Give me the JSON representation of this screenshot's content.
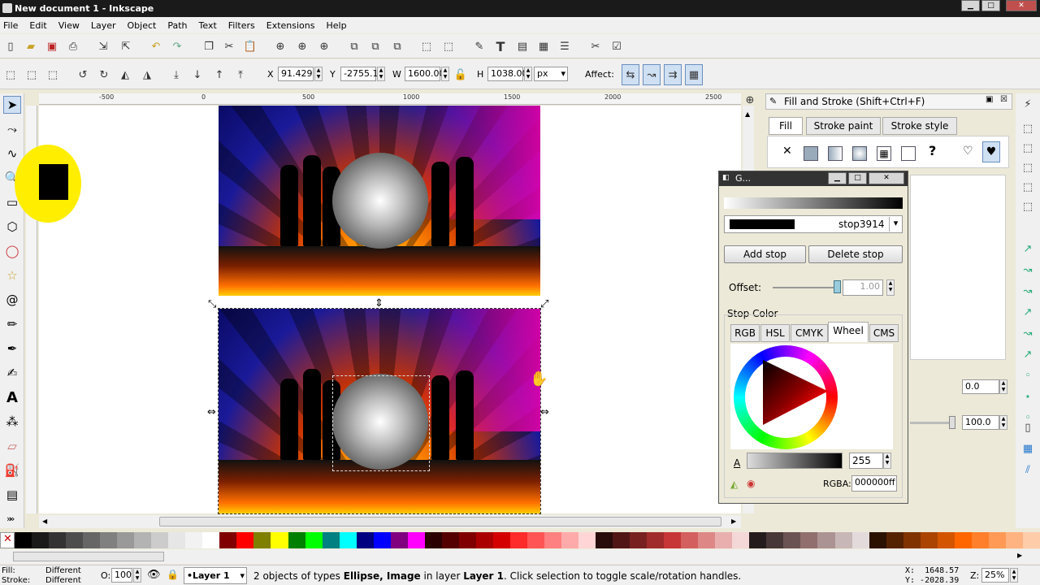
{
  "window": {
    "title": "New document 1 - Inkscape"
  },
  "menu": [
    "File",
    "Edit",
    "View",
    "Layer",
    "Object",
    "Path",
    "Text",
    "Filters",
    "Extensions",
    "Help"
  ],
  "toolbar": {
    "x_label": "X",
    "x_value": "91.429",
    "y_label": "Y",
    "y_value": "-2755.1!",
    "w_label": "W",
    "w_value": "1600.00",
    "h_label": "H",
    "h_value": "1038.00",
    "unit": "px",
    "affect_label": "Affect:"
  },
  "ruler": {
    "marks": [
      "-500",
      "0",
      "500",
      "1000",
      "1500",
      "2000",
      "2500"
    ]
  },
  "fill_stroke": {
    "title": "Fill and Stroke (Shift+Ctrl+F)",
    "tabs": [
      "Fill",
      "Stroke paint",
      "Stroke style"
    ],
    "blur_value": "0.0",
    "opacity_value": "100.0"
  },
  "gradient": {
    "title": "G...",
    "stop_name": "stop3914",
    "add_stop": "Add stop",
    "delete_stop": "Delete stop",
    "offset_label": "Offset:",
    "offset_value": "1.00",
    "stop_color_label": "Stop Color",
    "tabs": [
      "RGB",
      "HSL",
      "CMYK",
      "Wheel",
      "CMS"
    ],
    "alpha_label": "A",
    "alpha_value": "255",
    "rgba_label": "RGBA:",
    "rgba_value": "000000ff"
  },
  "status": {
    "fill_label": "Fill:",
    "fill_value": "Different",
    "stroke_label": "Stroke:",
    "stroke_value": "Different",
    "opacity_label": "O:",
    "opacity_value": "100",
    "layer": "•Layer 1",
    "message_pre": "2 objects of types ",
    "message_types": "Ellipse, Image",
    "message_mid": " in layer ",
    "message_layer": "Layer 1",
    "message_post": ". Click selection to toggle scale/rotation handles.",
    "x_coord": "X:  1648.57",
    "y_coord": "Y: -2028.39",
    "zoom_label": "Z:",
    "zoom_value": "25%"
  },
  "palette": [
    "#000000",
    "#1a1a1a",
    "#333333",
    "#4d4d4d",
    "#666666",
    "#808080",
    "#999999",
    "#b3b3b3",
    "#cccccc",
    "#e6e6e6",
    "#f2f2f2",
    "#ffffff",
    "#800000",
    "#ff0000",
    "#808000",
    "#ffff00",
    "#008000",
    "#00ff00",
    "#008080",
    "#00ffff",
    "#000080",
    "#0000ff",
    "#800080",
    "#ff00ff",
    "#2b0000",
    "#550000",
    "#800000",
    "#aa0000",
    "#d40000",
    "#ff2a2a",
    "#ff5555",
    "#ff8080",
    "#ffaaaa",
    "#ffd5d5",
    "#280b0b",
    "#501616",
    "#782121",
    "#a02c2c",
    "#c83737",
    "#d35f5f",
    "#de8787",
    "#e9afaf",
    "#f4d7d7",
    "#241c1c",
    "#483737",
    "#6c5353",
    "#916f6f",
    "#ac9393",
    "#c8b7b7",
    "#e3dbdb",
    "#2b1100",
    "#552200",
    "#803300",
    "#aa4400",
    "#d45500",
    "#ff6600",
    "#ff7f2a",
    "#ff9955",
    "#ffb380",
    "#ffccaa"
  ]
}
